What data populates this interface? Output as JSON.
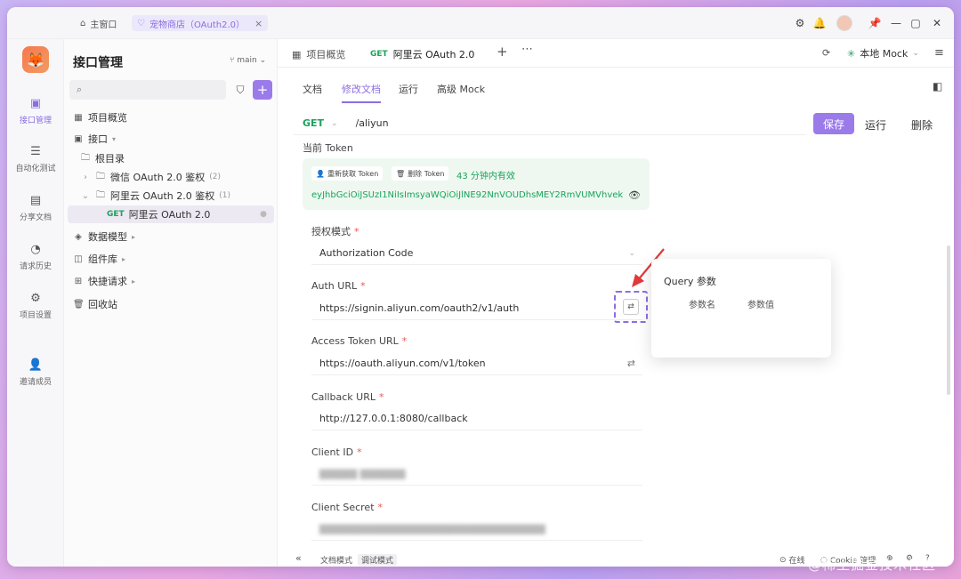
{
  "titlebar": {
    "home_tab": "主窗口",
    "active_tab": "宠物商店（OAuth2.0）",
    "close_glyph": "×"
  },
  "rail": {
    "items": [
      {
        "label": "接口管理",
        "icon": "api-icon"
      },
      {
        "label": "自动化测试",
        "icon": "automation-icon"
      },
      {
        "label": "分享文档",
        "icon": "share-doc-icon"
      },
      {
        "label": "请求历史",
        "icon": "history-icon"
      },
      {
        "label": "项目设置",
        "icon": "settings-icon"
      },
      {
        "label": "邀请成员",
        "icon": "invite-icon"
      }
    ]
  },
  "tree": {
    "title": "接口管理",
    "branch": "main",
    "rows": [
      {
        "label": "项目概览"
      },
      {
        "label": "接口"
      },
      {
        "label": "根目录"
      },
      {
        "label": "微信 OAuth 2.0 鉴权",
        "count": "(2)"
      },
      {
        "label": "阿里云 OAuth 2.0 鉴权",
        "count": "(1)"
      },
      {
        "method": "GET",
        "label": "阿里云 OAuth 2.0"
      },
      {
        "label": "数据模型"
      },
      {
        "label": "组件库"
      },
      {
        "label": "快捷请求"
      },
      {
        "label": "回收站"
      }
    ]
  },
  "main": {
    "tabs": {
      "overview": "项目概览",
      "active_method": "GET",
      "active_label": "阿里云 OAuth 2.0"
    },
    "env": "本地 Mock",
    "sub_tabs": [
      "文档",
      "修改文档",
      "运行",
      "高级 Mock"
    ],
    "url": {
      "method": "GET",
      "path": "/aliyun"
    },
    "buttons": {
      "save": "保存",
      "run": "运行",
      "delete": "删除"
    },
    "token": {
      "label": "当前 Token",
      "refresh": "重新获取 Token",
      "delete": "删除 Token",
      "valid": "43 分钟内有效",
      "value": "eyJhbGciOiJSUzI1NiIsImsyaWQiOiJlNE92NnVOUDhsMEY2RmVUMVhvek5wb..."
    },
    "fields": {
      "auth_mode_label": "授权模式",
      "auth_mode_value": "Authorization Code",
      "auth_url_label": "Auth URL",
      "auth_url_value": "https://signin.aliyun.com/oauth2/v1/auth",
      "token_url_label": "Access Token URL",
      "token_url_value": "https://oauth.aliyun.com/v1/token",
      "callback_label": "Callback URL",
      "callback_value": "http://127.0.0.1:8080/callback",
      "client_id_label": "Client ID",
      "client_secret_label": "Client Secret"
    },
    "popover": {
      "title": "Query 参数",
      "col_name": "参数名",
      "col_value": "参数值"
    }
  },
  "statusbar": {
    "collapse": "«",
    "doc_mode": "文档模式",
    "debug_mode": "调试模式",
    "online": "在线",
    "cookie": "Cookie 管理"
  },
  "watermark": "@稀土掘金技术社区",
  "colors": {
    "accent": "#9b7bea",
    "get": "#1aa35b",
    "token_bg": "#eef8f0"
  }
}
